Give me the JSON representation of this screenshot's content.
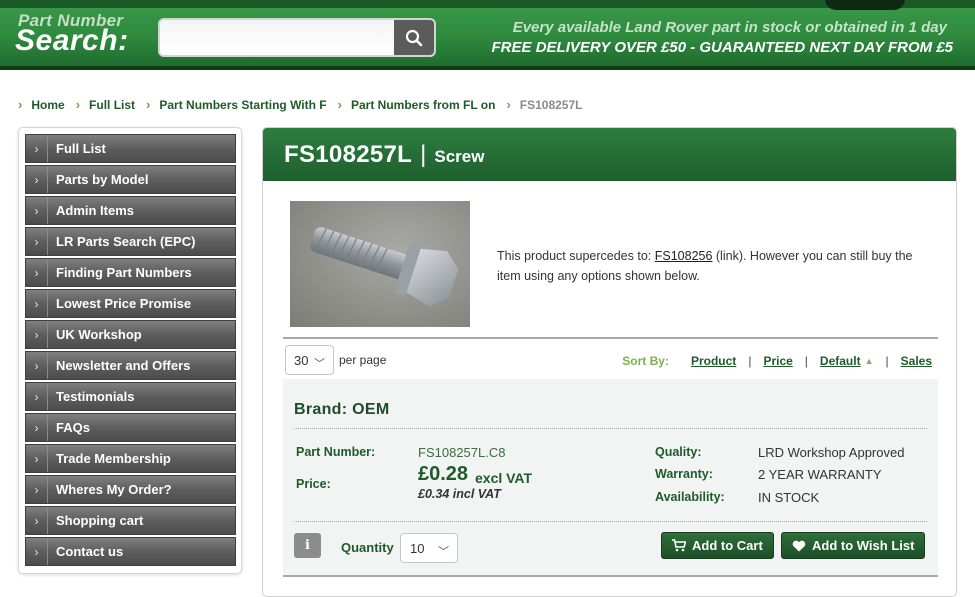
{
  "header": {
    "logo_small": "Part Number",
    "logo_large": "Search:",
    "search_placeholder": "",
    "search_icon": "search-icon",
    "tagline_1": "Every available Land Rover part in stock or obtained in 1 day",
    "tagline_2": "FREE DELIVERY OVER £50 - GUARANTEED NEXT DAY FROM £5"
  },
  "breadcrumb": {
    "items": [
      "Home",
      "Full List",
      "Part Numbers Starting With F",
      "Part Numbers from FL on"
    ],
    "current": "FS108257L"
  },
  "sidebar": {
    "items": [
      {
        "label": "Full List"
      },
      {
        "label": "Parts by Model"
      },
      {
        "label": "Admin Items"
      },
      {
        "label": "LR Parts Search (EPC)"
      },
      {
        "label": "Finding Part Numbers"
      },
      {
        "label": "Lowest Price Promise"
      },
      {
        "label": "UK Workshop"
      },
      {
        "label": "Newsletter and Offers"
      },
      {
        "label": "Testimonials"
      },
      {
        "label": "FAQs"
      },
      {
        "label": "Trade Membership"
      },
      {
        "label": "Wheres My Order?"
      },
      {
        "label": "Shopping cart"
      },
      {
        "label": "Contact us"
      }
    ]
  },
  "product": {
    "part_number": "FS108257L",
    "separator": "|",
    "description": "Screw",
    "supercede_text_before": "This product supercedes to: ",
    "supercede_link": "FS108256",
    "supercede_text_after": " (link). However you can still buy the item using any options shown below."
  },
  "listing": {
    "per_page_value": "30",
    "per_page_label": "per page",
    "sort_by_label": "Sort By:",
    "sort_options": [
      "Product",
      "Price",
      "Default",
      "Sales"
    ]
  },
  "offer": {
    "brand_title": "Brand: OEM",
    "part_number_label": "Part Number:",
    "part_number_value": "FS108257L.C8",
    "price_label": "Price:",
    "price_value": "£0.28",
    "price_excl": "excl VAT",
    "price_incl": "£0.34 incl VAT",
    "quality_label": "Quality:",
    "quality_value": "LRD Workshop Approved",
    "warranty_label": "Warranty:",
    "warranty_value": "2 YEAR WARRANTY",
    "availability_label": "Availability:",
    "availability_value": "IN STOCK",
    "info_button": "i",
    "quantity_label": "Quantity",
    "quantity_value": "10",
    "add_to_cart": "Add to Cart",
    "add_to_wishlist": "Add to Wish List"
  },
  "colors": {
    "header_green": "#2f8a3e",
    "panel_green": "#1e5f2e",
    "link_green": "#1f5a2a",
    "accent_light_green": "#7fb04f",
    "sidebar_gray": "#5e5e5e"
  }
}
